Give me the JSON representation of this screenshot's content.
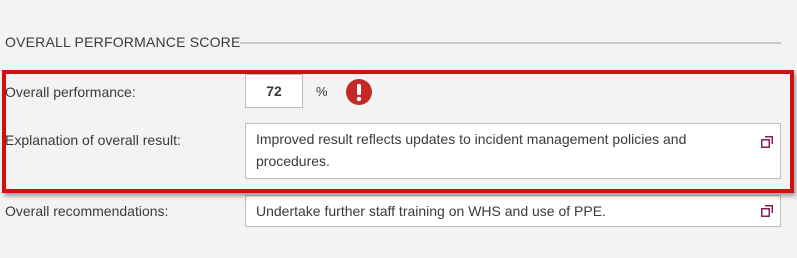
{
  "section": {
    "title": "OVERALL PERFORMANCE SCORE"
  },
  "performance": {
    "label": "Overall performance:",
    "value": "72",
    "unit": "%",
    "status_icon": "exclamation-circle-icon",
    "status_color": "#c62828"
  },
  "explanation": {
    "label": "Explanation of overall result:",
    "value": "Improved result reflects updates to incident management policies and procedures.",
    "expand_icon": "expand-icon"
  },
  "recommendations": {
    "label": "Overall recommendations:",
    "value": "Undertake further staff training on WHS and use of PPE.",
    "expand_icon": "expand-icon"
  },
  "colors": {
    "highlight": "#d20f0f",
    "expand_icon": "#8b1a5c"
  }
}
